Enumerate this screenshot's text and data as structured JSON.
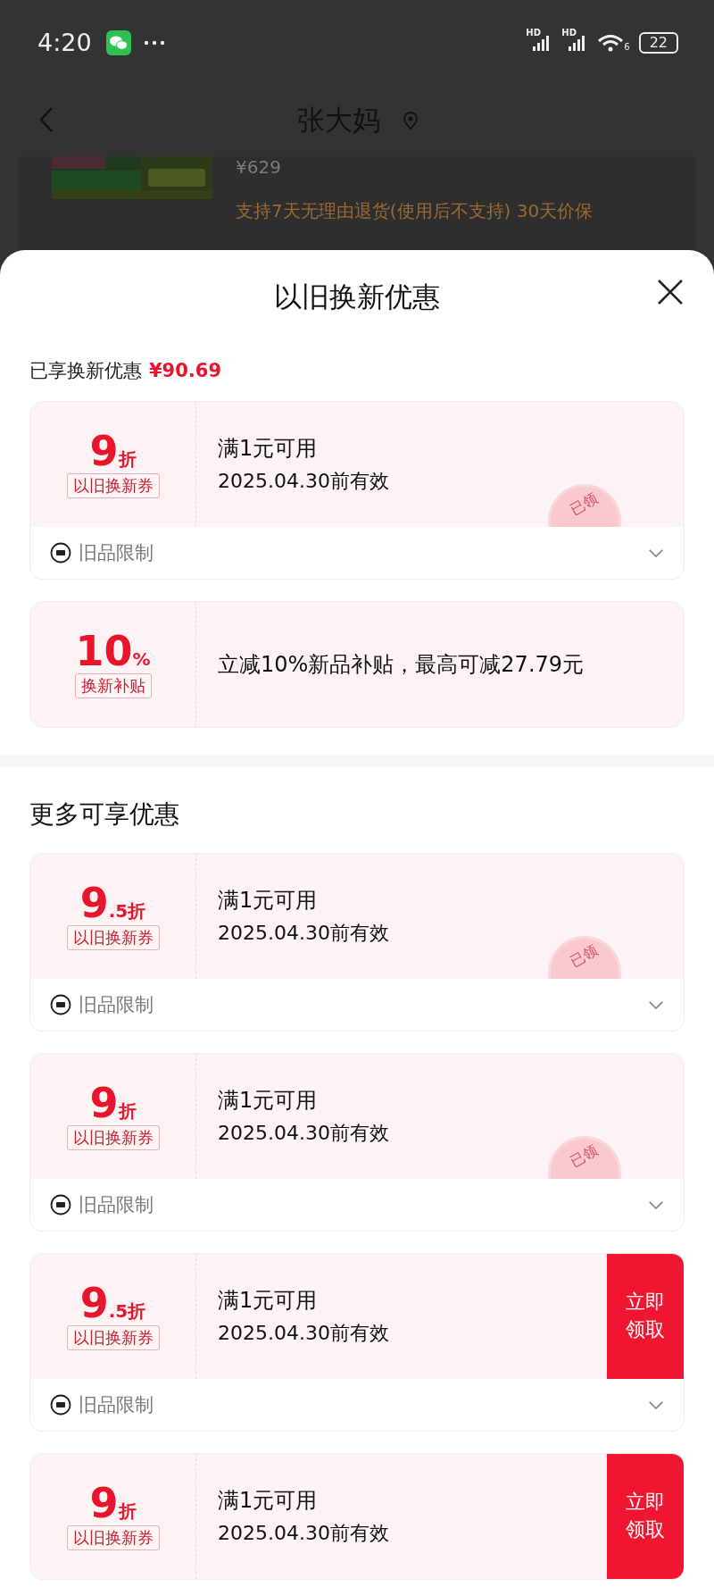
{
  "status_bar": {
    "time": "4:20",
    "signal_labels": [
      "HD",
      "HD"
    ],
    "wifi_label": "6",
    "battery": "22"
  },
  "header": {
    "title": "张大妈"
  },
  "product": {
    "price": "¥629",
    "note": "支持7天无理由退货(使用后不支持)  30天价保"
  },
  "sheet": {
    "title": "以旧换新优惠",
    "saved_label": "已享换新优惠",
    "saved_amount": "¥90.69"
  },
  "applied": [
    {
      "kind": "coupon",
      "value": "9",
      "unit": "折",
      "tag": "以旧换新券",
      "line1": "满1元可用",
      "line2": "2025.04.30前有效",
      "claimed": true,
      "stamp": "已领",
      "restriction": "旧品限制"
    },
    {
      "kind": "subsidy",
      "value": "10",
      "unit": "%",
      "tag": "换新补贴",
      "line1": "立减10%新品补贴，最高可减27.79元"
    }
  ],
  "more": {
    "title": "更多可享优惠",
    "coupons": [
      {
        "kind": "coupon",
        "value": "9",
        "unit": ".5折",
        "tag": "以旧换新券",
        "line1": "满1元可用",
        "line2": "2025.04.30前有效",
        "claimed": true,
        "stamp": "已领",
        "restriction": "旧品限制"
      },
      {
        "kind": "coupon",
        "value": "9",
        "unit": "折",
        "tag": "以旧换新券",
        "line1": "满1元可用",
        "line2": "2025.04.30前有效",
        "claimed": true,
        "stamp": "已领",
        "restriction": "旧品限制"
      },
      {
        "kind": "coupon",
        "value": "9",
        "unit": ".5折",
        "tag": "以旧换新券",
        "line1": "满1元可用",
        "line2": "2025.04.30前有效",
        "claimed": false,
        "action": "立即领取",
        "restriction": "旧品限制"
      },
      {
        "kind": "coupon",
        "value": "9",
        "unit": "折",
        "tag": "以旧换新券",
        "line1": "满1元可用",
        "line2": "2025.04.30前有效",
        "claimed": false,
        "action": "立即领取"
      }
    ]
  }
}
